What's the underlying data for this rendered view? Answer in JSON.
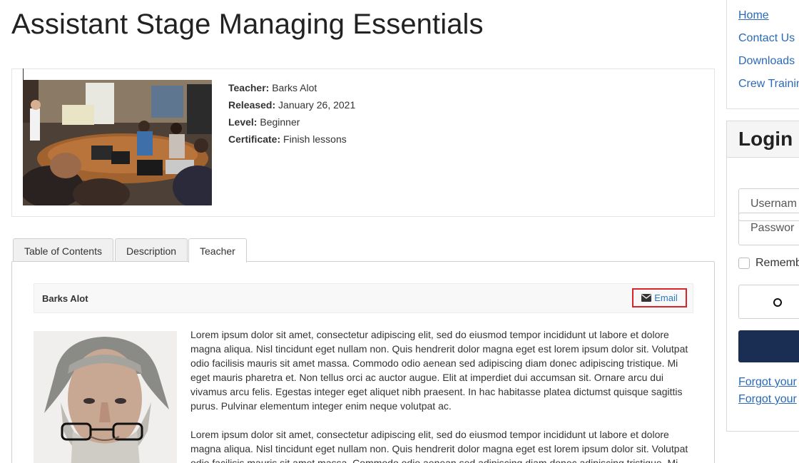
{
  "page": {
    "title": "Assistant Stage Managing Essentials"
  },
  "course": {
    "teacher_label": "Teacher:",
    "teacher": "Barks Alot",
    "released_label": "Released:",
    "released": "January 26, 2021",
    "level_label": "Level:",
    "level": "Beginner",
    "certificate_label": "Certificate:",
    "certificate": "Finish lessons"
  },
  "tabs": [
    "Table of Contents",
    "Description",
    "Teacher"
  ],
  "active_tab": "Teacher",
  "teacher_panel": {
    "name": "Barks Alot",
    "email_label": "Email",
    "paragraphs": [
      "Lorem ipsum dolor sit amet, consectetur adipiscing elit, sed do eiusmod tempor incididunt ut labore et dolore magna aliqua. Nisl tincidunt eget nullam non. Quis hendrerit dolor magna eget est lorem ipsum dolor sit. Volutpat odio facilisis mauris sit amet massa. Commodo odio aenean sed adipiscing diam donec adipiscing tristique. Mi eget mauris pharetra et. Non tellus orci ac auctor augue. Elit at imperdiet dui accumsan sit. Ornare arcu dui vivamus arcu felis. Egestas integer eget aliquet nibh praesent. In hac habitasse platea dictumst quisque sagittis purus. Pulvinar elementum integer enim neque volutpat ac.",
      "Lorem ipsum dolor sit amet, consectetur adipiscing elit, sed do eiusmod tempor incididunt ut labore et dolore magna aliqua. Nisl tincidunt eget nullam non. Quis hendrerit dolor magna eget est lorem ipsum dolor sit. Volutpat odio facilisis mauris sit amet massa. Commodo odio aenean sed adipiscing diam donec adipiscing tristique. Mi"
    ]
  },
  "side_nav": {
    "home": "Home",
    "contact": "Contact Us",
    "downloads": "Downloads",
    "crew": "Crew Trainin"
  },
  "login": {
    "title": "Login",
    "username_placeholder": "Usernam",
    "password_placeholder": "Passwor",
    "remember": "Rememb",
    "forgot_password": "Forgot your",
    "forgot_username": "Forgot your"
  },
  "colors": {
    "link": "#2a6ab8",
    "submit": "#1a2d52",
    "email_highlight": "#d9242b"
  }
}
